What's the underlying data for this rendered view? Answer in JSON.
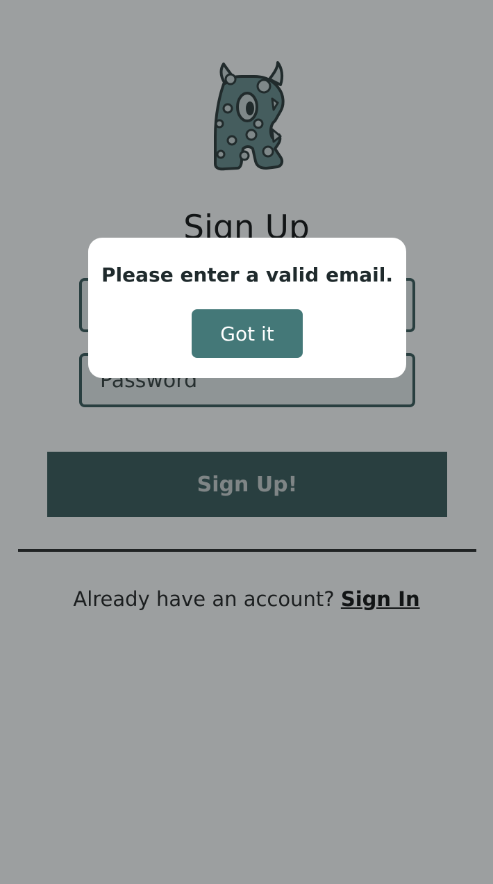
{
  "page": {
    "title": "Sign Up"
  },
  "form": {
    "email_placeholder": "",
    "password_placeholder": "Password",
    "submit_label": "Sign Up!"
  },
  "signin": {
    "prompt": "Already have an account?",
    "link_label": "Sign In"
  },
  "alert": {
    "message": "Please enter a valid email.",
    "button_label": "Got it"
  },
  "icons": {
    "logo": "monster-logo-icon"
  },
  "colors": {
    "primary": "#2c4f4f",
    "accent": "#447878",
    "logo_fill": "#5f8585"
  }
}
